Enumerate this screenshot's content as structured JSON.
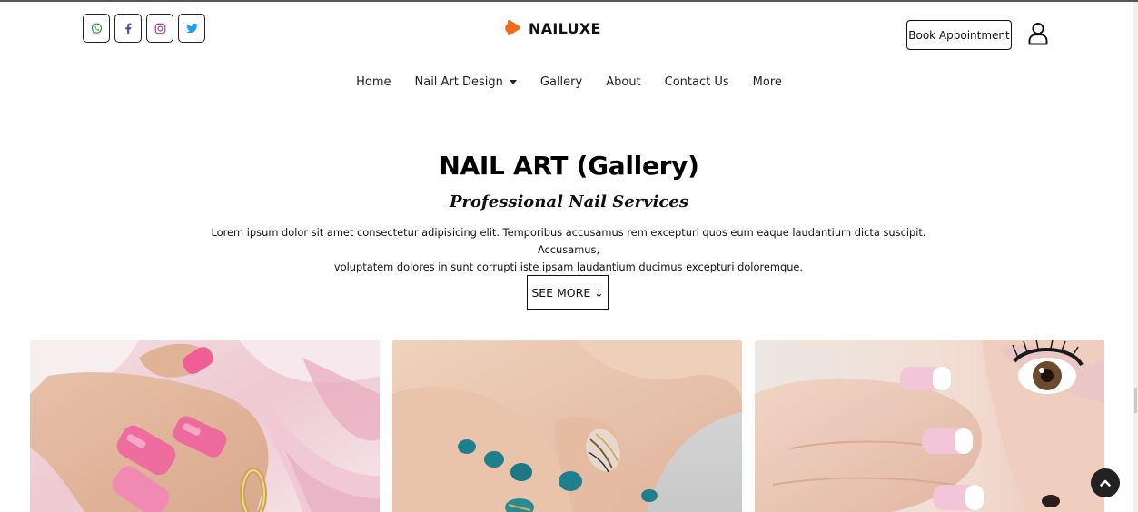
{
  "header": {
    "socials": [
      {
        "icon": "whatsapp-icon",
        "color": "#25a244"
      },
      {
        "icon": "facebook-icon",
        "color": "#3b5998"
      },
      {
        "icon": "instagram-icon",
        "color": "#c13584"
      },
      {
        "icon": "twitter-icon",
        "color": "#1da1f2"
      }
    ],
    "brand": {
      "name": "NAILUXE",
      "logo_icon": "play-logo-icon",
      "logo_color": "#f26b1d"
    },
    "book_label": "Book Appointment",
    "user_icon": "user-icon"
  },
  "nav": {
    "items": [
      "Home",
      "Nail Art Design",
      "Gallery",
      "About",
      "Contact Us",
      "More"
    ]
  },
  "hero": {
    "title": "NAIL ART (Gallery)",
    "subtitle": "Professional Nail Services",
    "text_line1": "Lorem ipsum dolor sit amet consectetur adipisicing elit. Temporibus accusamus rem excepturi quos eum eaque laudantium dicta suscipit. Accusamus,",
    "text_line2": "voluptatem dolores in sunt corrupti iste ipsam laudantium ducimus excepturi doloremque.",
    "cta_label": "SEE MORE ↓"
  },
  "gallery": {
    "images": [
      "pink-nails-lily-image",
      "teal-toenails-image",
      "french-manicure-image"
    ]
  },
  "scroll_top_icon": "arrow-up-icon"
}
